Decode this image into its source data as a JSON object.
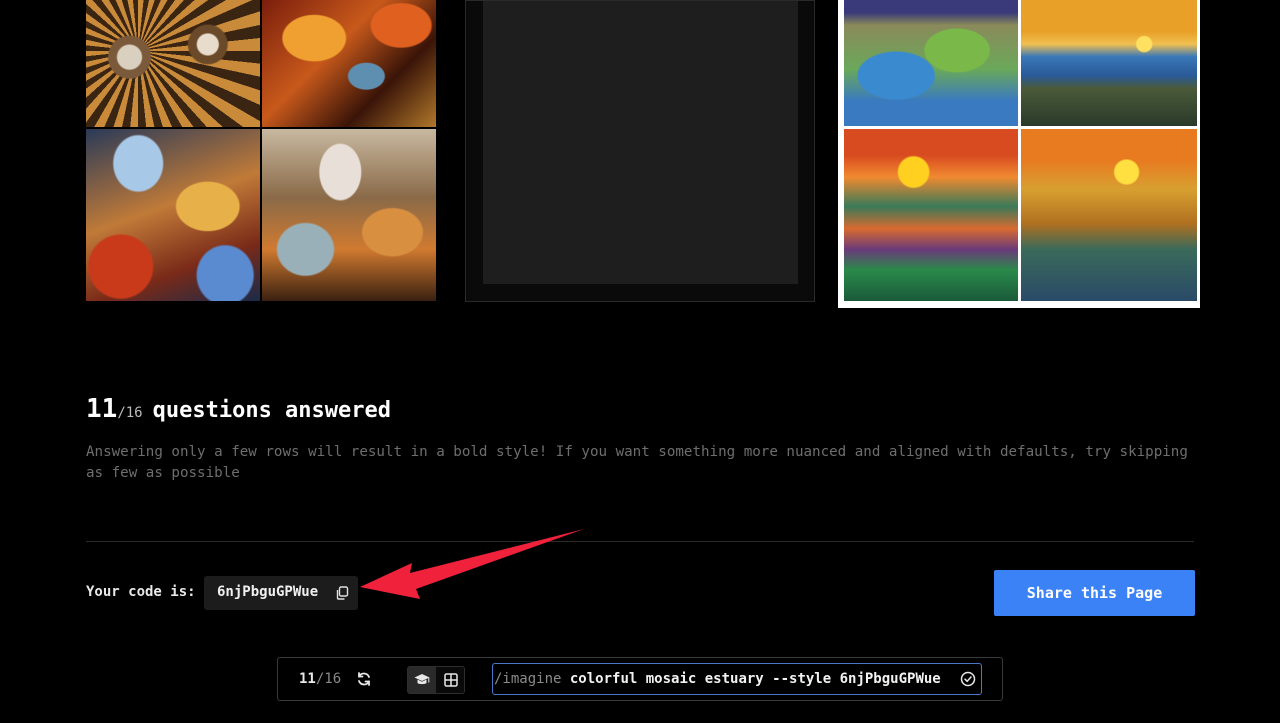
{
  "gallery": {
    "tiles": [
      {
        "name": "mosaic-collage-left",
        "selected": false
      },
      {
        "name": "placeholder-middle",
        "selected": false
      },
      {
        "name": "landscape-collage-right",
        "selected": true
      }
    ]
  },
  "questions": {
    "answered": "11",
    "total": "/16",
    "label": "questions answered",
    "description": "Answering only a few rows will result in a bold style! If you want something more nuanced and aligned with defaults, try skipping as few as possible"
  },
  "code": {
    "label": "Your code is:",
    "value": "6njPbguGPWue",
    "copy_icon": "copy-icon"
  },
  "share": {
    "label": "Share this Page"
  },
  "bottom_bar": {
    "progress_current": "11",
    "progress_total": "/16",
    "refresh_icon": "refresh-icon",
    "mode_icons": [
      "graduation-cap-icon",
      "grid-icon"
    ],
    "prompt_command": "/imagine",
    "prompt_text": " colorful mosaic estuary --style 6njPbguGPWue",
    "status_icon": "check-circle-icon"
  },
  "colors": {
    "accent": "#3b82f6",
    "background": "#000000",
    "muted_text": "#6e6e6e",
    "annotation_arrow": "#f0213a"
  }
}
